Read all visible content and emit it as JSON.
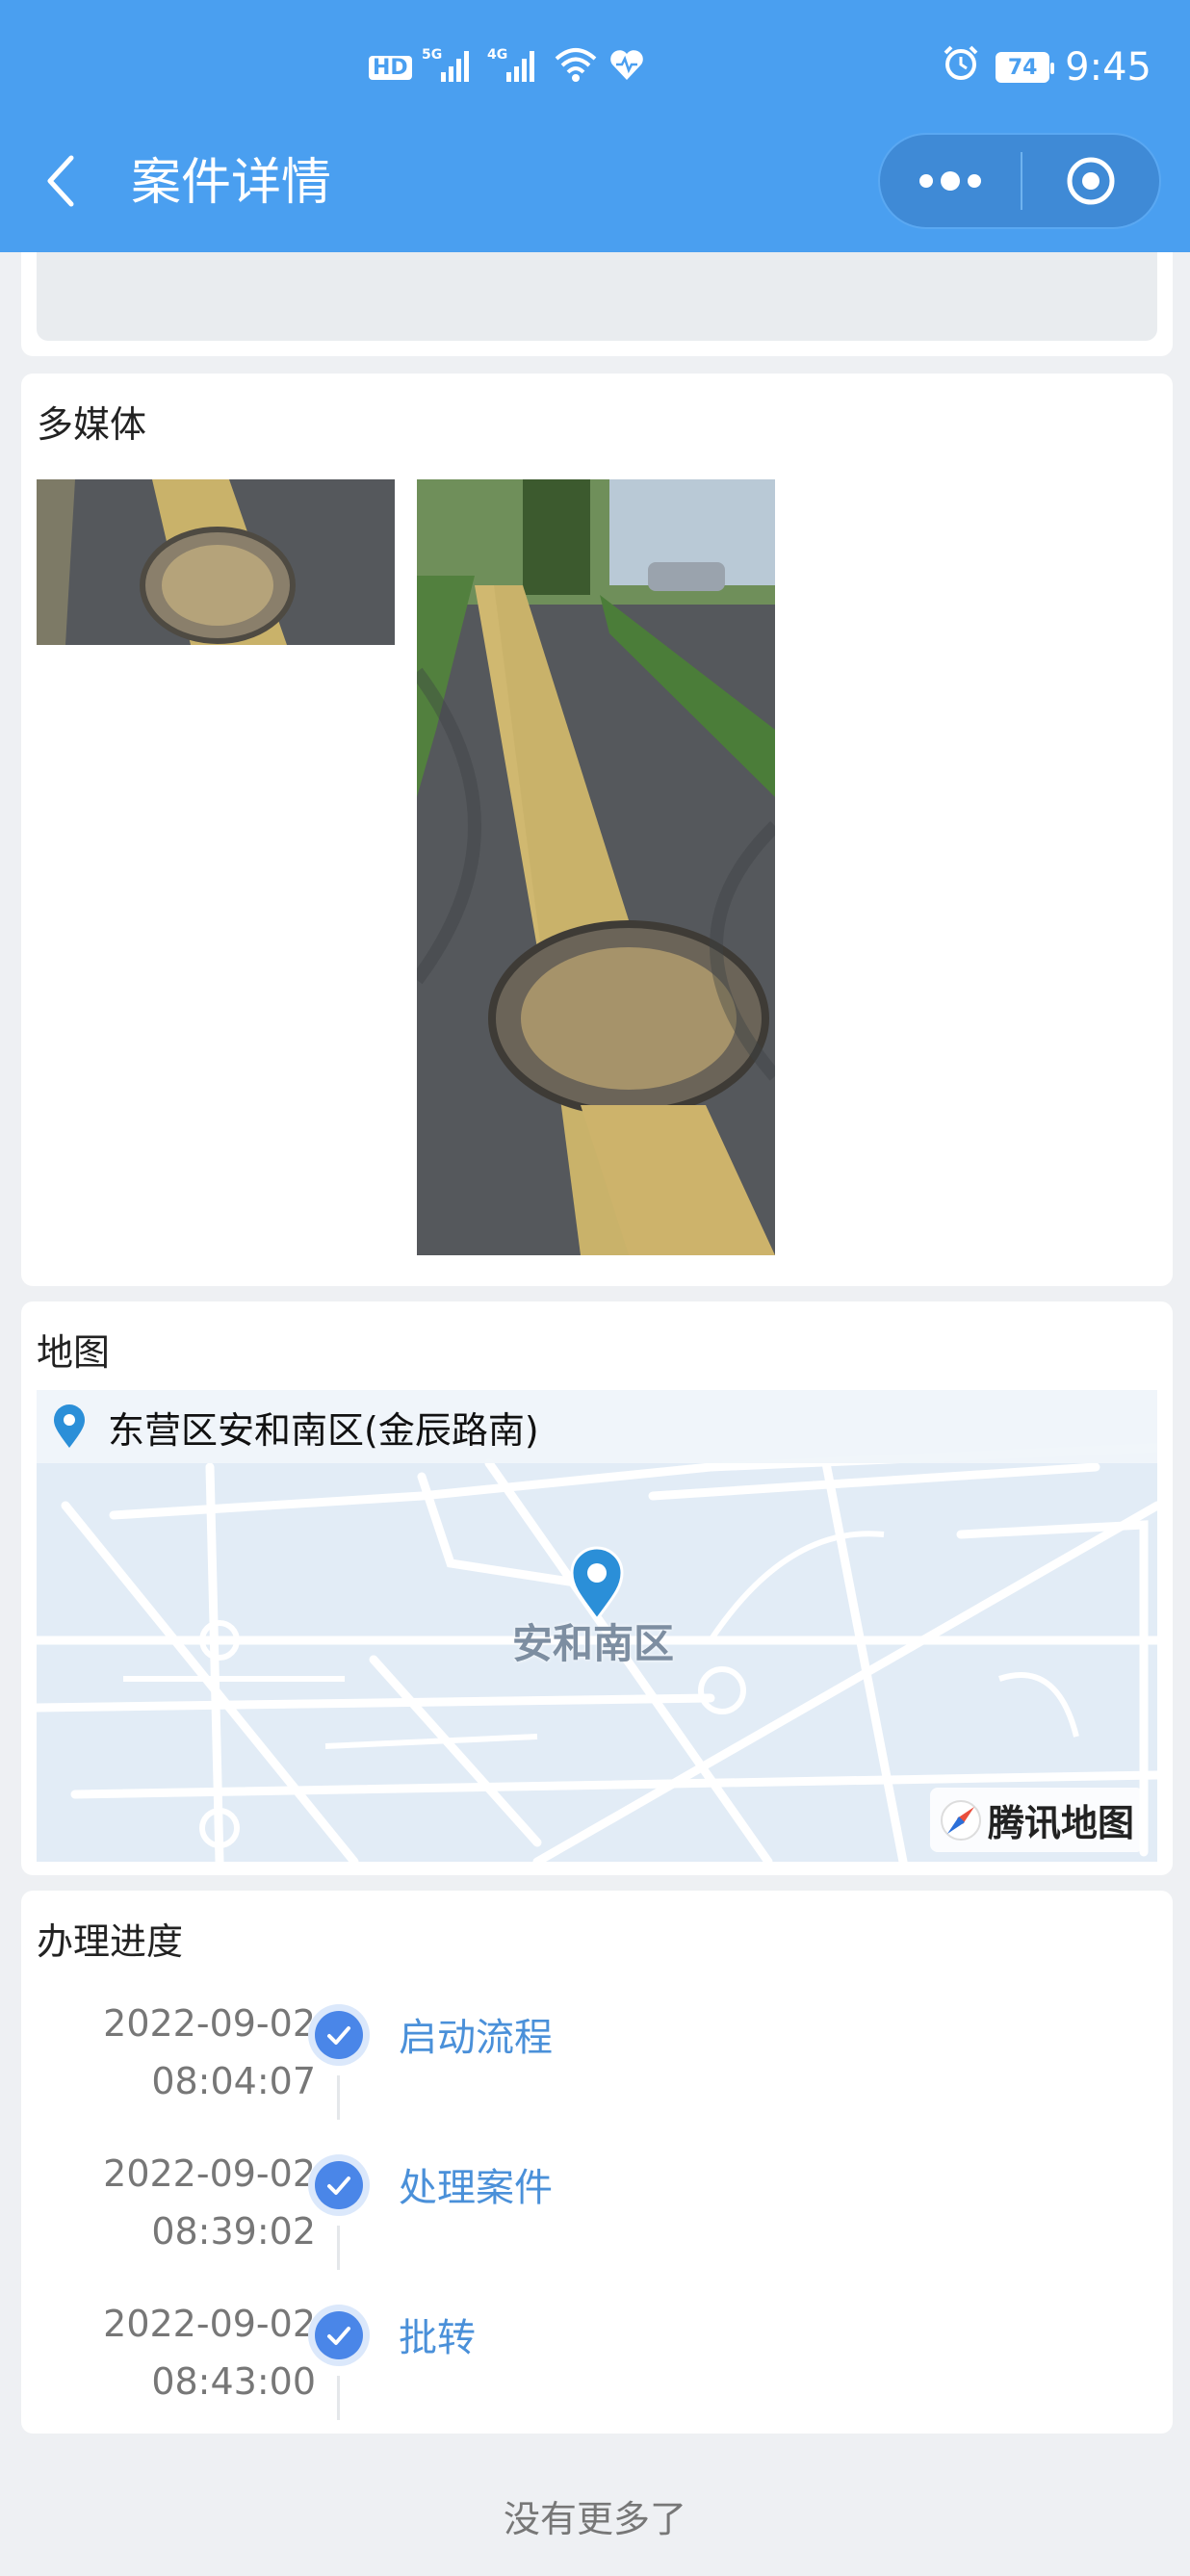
{
  "status_bar": {
    "left_icons": [
      "HD",
      "5G",
      "4G"
    ],
    "battery": "74",
    "time": "9:45"
  },
  "nav": {
    "title": "案件详情"
  },
  "media_section": {
    "title": "多媒体"
  },
  "map_section": {
    "title": "地图",
    "address": "东营区安和南区(金辰路南)",
    "map_label": "安和南区",
    "provider": "腾讯地图"
  },
  "progress_section": {
    "title": "办理进度",
    "steps": [
      {
        "date": "2022-09-02",
        "time": "08:04:07",
        "label": "启动流程"
      },
      {
        "date": "2022-09-02",
        "time": "08:39:02",
        "label": "处理案件"
      },
      {
        "date": "2022-09-02",
        "time": "08:43:00",
        "label": "批转"
      }
    ]
  },
  "footer": {
    "text": "没有更多了"
  },
  "colors": {
    "header": "#4a9ff0",
    "accent": "#4a90d9",
    "page_bg": "#eef0f3"
  }
}
